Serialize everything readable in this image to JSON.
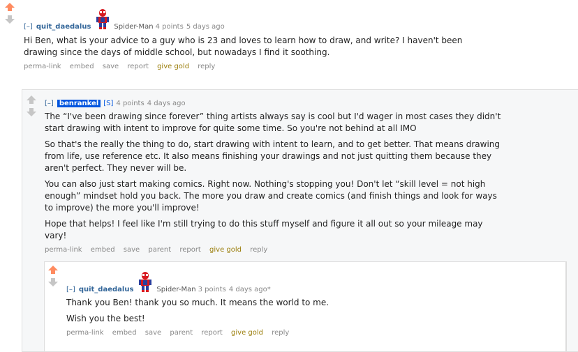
{
  "comment1": {
    "toggle": "[–]",
    "author": "quit_daedalus",
    "flair": "Spider-Man",
    "points": "4 points",
    "time": "5 days ago",
    "body": [
      "Hi Ben, what is your advice to a guy who is 23 and loves to learn how to draw, and write? I haven't been drawing since the days of middle school, but nowadays I find it soothing."
    ],
    "buttons": [
      "perma-link",
      "embed",
      "save",
      "report",
      "give gold",
      "reply"
    ]
  },
  "comment2": {
    "toggle": "[–]",
    "author": "benrankel",
    "submitter_tag": "[S]",
    "points": "4 points",
    "time": "4 days ago",
    "body": [
      "The “I've been drawing since forever” thing artists always say is cool but I'd wager in most cases they didn't start drawing with intent to improve for quite some time. So you're not behind at all IMO",
      "So that's the really the thing to do, start drawing with intent to learn, and to get better. That means drawing from life, use reference etc. It also means finishing your drawings and not just quitting them because they aren't perfect. They never will be.",
      "You can also just start making comics. Right now. Nothing's stopping you! Don't let “skill level = not high enough” mindset hold you back. The more you draw and create comics (and finish things and look for ways to improve) the more you'll improve!",
      "Hope that helps! I feel like I'm still trying to do this stuff myself and figure it all out so your mileage may vary!"
    ],
    "buttons": [
      "perma-link",
      "embed",
      "save",
      "parent",
      "report",
      "give gold",
      "reply"
    ]
  },
  "comment3": {
    "toggle": "[–]",
    "author": "quit_daedalus",
    "flair": "Spider-Man",
    "points": "3 points",
    "time": "4 days ago*",
    "body": [
      "Thank you Ben! thank you so much. It means the world to me.",
      "Wish you the best!"
    ],
    "buttons": [
      "perma-link",
      "embed",
      "save",
      "parent",
      "report",
      "give gold",
      "reply"
    ]
  },
  "colors": {
    "upvoted": "#ff8b60",
    "neutral_arrow": "#c6c6c6",
    "author_link": "#336699",
    "gold": "#9a7d0a",
    "op_badge": "#0055df"
  }
}
